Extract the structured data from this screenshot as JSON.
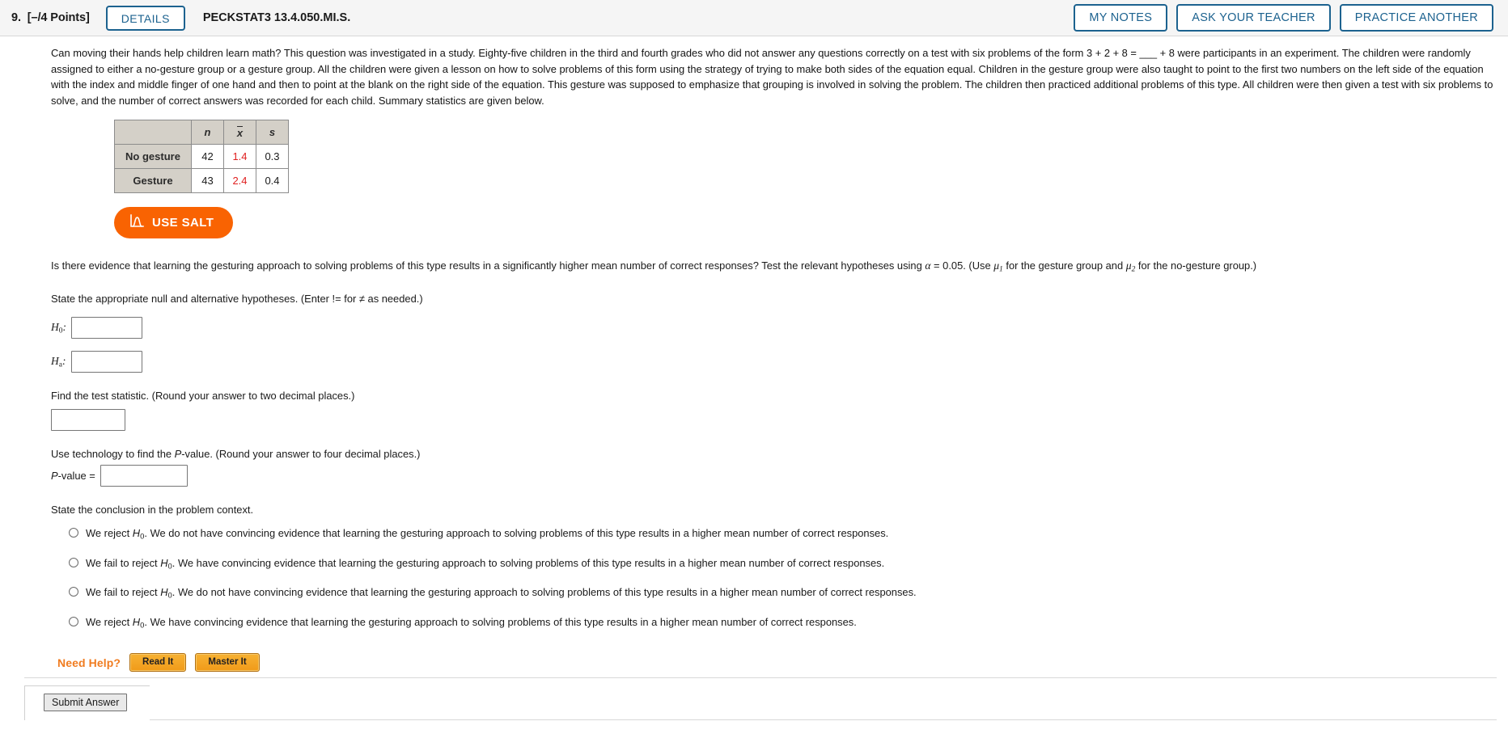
{
  "header": {
    "question_number": "9.",
    "points": "[–/4 Points]",
    "details_label": "DETAILS",
    "question_code": "PECKSTAT3 13.4.050.MI.S.",
    "my_notes_label": "MY NOTES",
    "ask_teacher_label": "ASK YOUR TEACHER",
    "practice_another_label": "PRACTICE ANOTHER"
  },
  "prompt": "Can moving their hands help children learn math? This question was investigated in a study. Eighty-five children in the third and fourth grades who did not answer any questions correctly on a test with six problems of the form 3 + 2 + 8 = ___ + 8 were participants in an experiment. The children were randomly assigned to either a no-gesture group or a gesture group. All the children were given a lesson on how to solve problems of this form using the strategy of trying to make both sides of the equation equal. Children in the gesture group were also taught to point to the first two numbers on the left side of the equation with the index and middle finger of one hand and then to point at the blank on the right side of the equation. This gesture was supposed to emphasize that grouping is involved in solving the problem. The children then practiced additional problems of this type. All children were then given a test with six problems to solve, and the number of correct answers was recorded for each child. Summary statistics are given below.",
  "stats_table": {
    "corner": "",
    "columns": [
      "n",
      "x̄",
      "s"
    ],
    "rows": [
      {
        "label": "No gesture",
        "n": "42",
        "xbar": "1.4",
        "s": "0.3"
      },
      {
        "label": "Gesture",
        "n": "43",
        "xbar": "2.4",
        "s": "0.4"
      }
    ],
    "header_bg": "#d4d0c8",
    "mean_color": "#e02020"
  },
  "salt_button": {
    "label": "USE SALT",
    "icon": "distribution-curve-icon",
    "color": "#f96302"
  },
  "question_text_parts": {
    "p1": "Is there evidence that learning the gesturing approach to solving problems of this type results in a significantly higher mean number of correct responses? Test the relevant hypotheses using ",
    "alpha": "α",
    "p2": " = 0.05. (Use ",
    "mu1": "μ",
    "mu1sub": "1",
    "p3": " for the gesture group and ",
    "mu2": "μ",
    "mu2sub": "2",
    "p4": " for the no-gesture group.)"
  },
  "hypotheses": {
    "instruction": "State the appropriate null and alternative hypotheses. (Enter != for ≠ as needed.)",
    "h0_label_base": "H",
    "h0_label_sub": "0",
    "h0_label_colon": ":",
    "h0_value": "",
    "ha_label_base": "H",
    "ha_label_sub": "a",
    "ha_label_colon": ":",
    "ha_value": ""
  },
  "test_statistic": {
    "instruction": "Find the test statistic. (Round your answer to two decimal places.)",
    "value": ""
  },
  "p_value": {
    "instruction_p1": "Use technology to find the ",
    "instruction_italic": "P",
    "instruction_p2": "-value. (Round your answer to four decimal places.)",
    "label_italic": "P",
    "label_rest": "-value =",
    "value": ""
  },
  "conclusion": {
    "instruction": "State the conclusion in the problem context.",
    "options": [
      {
        "pre": "We reject ",
        "h": "H",
        "hsub": "0",
        "post": ". We do not have convincing evidence that learning the gesturing approach to solving problems of this type results in a higher mean number of correct responses."
      },
      {
        "pre": "We fail to reject ",
        "h": "H",
        "hsub": "0",
        "post": ". We have convincing evidence that learning the gesturing approach to solving problems of this type results in a higher mean number of correct responses."
      },
      {
        "pre": "We fail to reject ",
        "h": "H",
        "hsub": "0",
        "post": ". We do not have convincing evidence that learning the gesturing approach to solving problems of this type results in a higher mean number of correct responses."
      },
      {
        "pre": "We reject ",
        "h": "H",
        "hsub": "0",
        "post": ". We have convincing evidence that learning the gesturing approach to solving problems of this type results in a higher mean number of correct responses."
      }
    ]
  },
  "need_help": {
    "label": "Need Help?",
    "read_it": "Read It",
    "master_it": "Master It",
    "accent_color": "#f07c20"
  },
  "submit": {
    "label": "Submit Answer"
  }
}
